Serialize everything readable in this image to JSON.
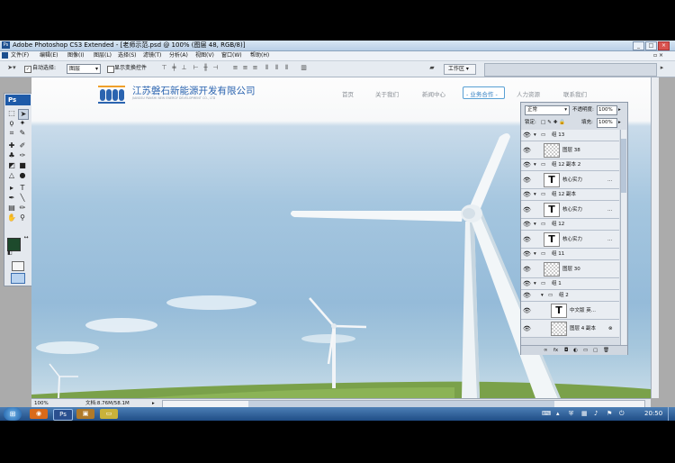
{
  "window": {
    "title": "Adobe Photoshop CS3 Extended - [老师示范.psd @ 100% (图层 48, RGB/8)]",
    "min": "_",
    "max": "□",
    "close": "×"
  },
  "menu": [
    "文件(F)",
    "编辑(E)",
    "图像(I)",
    "图层(L)",
    "选择(S)",
    "滤镜(T)",
    "分析(A)",
    "视图(V)",
    "窗口(W)",
    "帮助(H)"
  ],
  "options": {
    "auto_select_label": "自动选择:",
    "auto_select_value": "图层",
    "show_transform_label": "显示变换控件",
    "workspace_label": "工作区 ▾"
  },
  "toolbox": {
    "logo": "Ps"
  },
  "canvas": {
    "company_name": "江苏磐石新能源开发有限公司",
    "company_english": "JIANGSU PANSHI NEW ENERGY DEVELOPMENT CO., LTD",
    "nav": [
      "首页",
      "关于我们",
      "新闻中心",
      "业务合作",
      "人力资源",
      "联系我们"
    ],
    "nav_active": "- 业务合作 -"
  },
  "layers": {
    "blend_mode": "正常",
    "opacity_label": "不透明度:",
    "opacity_value": "100%",
    "lock_label": "锁定:",
    "fill_label": "填充:",
    "fill_value": "100%",
    "rows": [
      {
        "name": "组 13",
        "type": "group"
      },
      {
        "name": "图层 38",
        "type": "layer"
      },
      {
        "name": "组 12 副本 2",
        "type": "group"
      },
      {
        "name": "核心实力",
        "type": "text"
      },
      {
        "name": "组 12 副本",
        "type": "group"
      },
      {
        "name": "核心实力",
        "type": "text"
      },
      {
        "name": "组 12",
        "type": "group"
      },
      {
        "name": "核心实力",
        "type": "text"
      },
      {
        "name": "组 11",
        "type": "group"
      },
      {
        "name": "图层 30",
        "type": "layer"
      },
      {
        "name": "组 1",
        "type": "group"
      },
      {
        "name": "组 2",
        "type": "group"
      },
      {
        "name": "中文版   英...",
        "type": "text"
      },
      {
        "name": "图层 4 副本",
        "type": "layer"
      }
    ],
    "ellipsis": "..."
  },
  "status": {
    "zoom": "100%",
    "doc": "文档:8.76M/58.1M"
  },
  "taskbar": {
    "clock": "20:50"
  },
  "colors": {
    "foreground": "#1d4a2c",
    "background": "#ffffff",
    "logo_blue": "#2b64b0",
    "logo_orange": "#f0a02a",
    "nav_active_border": "#58a0d4"
  }
}
